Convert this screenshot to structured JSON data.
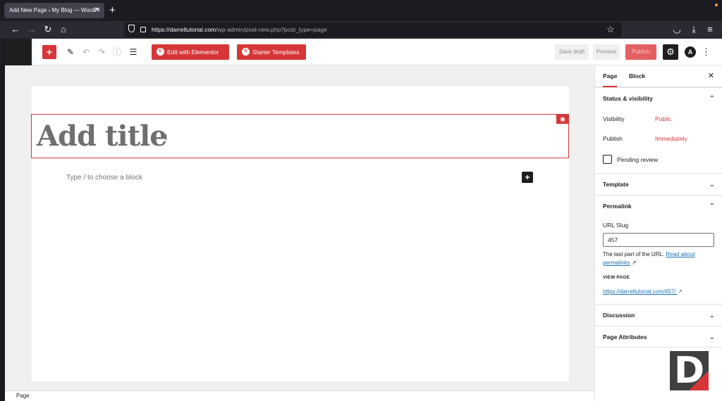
{
  "browser": {
    "tab_title": "Add New Page ‹ My Blog — WordPr",
    "tab_close": "✕",
    "new_tab": "+",
    "url_host": "https://darreltutorial.com",
    "url_path": "/wp-admin/post-new.php?post_type=page",
    "icons": [
      "back-icon",
      "forward-icon",
      "reload-icon",
      "home-icon",
      "shield-icon",
      "lock-icon",
      "star-icon",
      "pocket-icon",
      "download-icon",
      "menu-icon"
    ]
  },
  "toolbar": {
    "elementor_label": "Edit with Elementor",
    "starter_label": "Starter Templates",
    "save_draft": "Save draft",
    "preview": "Preview",
    "publish": "Publish"
  },
  "editor": {
    "title_placeholder": "Add title",
    "block_placeholder": "Type / to choose a block"
  },
  "statusbar": {
    "label": "Page"
  },
  "sidebar": {
    "tabs": [
      {
        "label": "Page"
      },
      {
        "label": "Block"
      }
    ],
    "status_heading": "Status & visibility",
    "visibility_label": "Visibility",
    "visibility_value": "Public",
    "publish_label": "Publish",
    "publish_value": "Immediately",
    "pending_review": "Pending review",
    "template_heading": "Template",
    "permalink_heading": "Permalink",
    "url_slug_label": "URL Slug",
    "url_slug_value": "457",
    "help_text": "The last part of the URL.",
    "help_link_1": "Read about",
    "help_link_2": "permalinks",
    "view_page_label": "VIEW PAGE",
    "view_page_link": "https://darreltutorial.com/457/",
    "discussion_heading": "Discussion",
    "attributes_heading": "Page Attributes"
  },
  "colors": {
    "accent": "#d63638",
    "link": "#2271b1",
    "dark": "#1e1e1e"
  }
}
